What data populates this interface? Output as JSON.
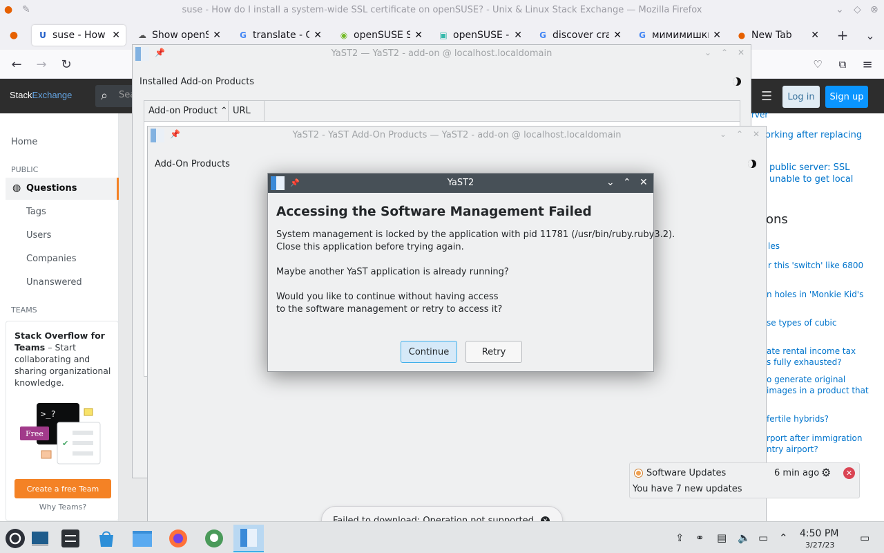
{
  "firefox": {
    "window_title": "suse - How do I install a system-wide SSL certificate on openSUSE? - Unix & Linux Stack Exchange — Mozilla Firefox",
    "tabs": [
      {
        "label": "suse - How do",
        "icon": "stackexchange-icon"
      },
      {
        "label": "Show openSU",
        "icon": "github-icon"
      },
      {
        "label": "translate - Go",
        "icon": "google-icon"
      },
      {
        "label": "openSUSE Sof",
        "icon": "opensuse-icon"
      },
      {
        "label": "openSUSE - Li",
        "icon": "opensuse-forum-icon"
      },
      {
        "label": "discover crash",
        "icon": "google-icon"
      },
      {
        "label": "мимимишки",
        "icon": "google-icon"
      },
      {
        "label": "New Tab",
        "icon": "firefox-icon"
      }
    ]
  },
  "se": {
    "logo_a": "Stack",
    "logo_b": "Exchange",
    "search_placeholder": "Sea",
    "login": "Log in",
    "signup": "Sign up",
    "nav_home": "Home",
    "nav_public": "PUBLIC",
    "nav_questions": "Questions",
    "nav_tags": "Tags",
    "nav_users": "Users",
    "nav_companies": "Companies",
    "nav_unanswered": "Unanswered",
    "nav_teams": "TEAMS",
    "teams_title": "Stack Overflow for Teams",
    "teams_desc": " – Start collaborating and sharing organizational knowledge.",
    "teams_free": "Free",
    "teams_prompt": ">_?",
    "create_team": "Create a free Team",
    "why_teams": "Why Teams?",
    "right": {
      "r0": "rver",
      "r1": "orking after replacing",
      "r2": "public server: SSL",
      "r3": "unable to get local",
      "heading": "ons",
      "r4": "les",
      "r5": "r this 'switch' like 6800",
      "r6": "n holes in 'Monkie Kid's",
      "r7": "se types of cubic",
      "r8": "ate rental income tax",
      "r9": "s fully exhausted?",
      "r10": "o generate original",
      "r11": "images in a product that",
      "r12": "fertile hybrids?",
      "r13": "rport after immigration",
      "r14": "ntry airport?"
    }
  },
  "yast1": {
    "title": "YaST2 — YaST2 - add-on @ localhost.localdomain",
    "heading": "Installed Add-on Products",
    "col_product": "Add-on Product ⌃",
    "col_url": "URL"
  },
  "yast2": {
    "title": "YaST2 - YaST Add-On Products — YaST2 - add-on @ localhost.localdomain",
    "heading": "Add-On Products"
  },
  "dialog": {
    "title": "YaST2",
    "heading": "Accessing the Software Management Failed",
    "line1": "System management is locked by the application with pid 11781 (/usr/bin/ruby.ruby3.2).",
    "line2": "Close this application before trying again.",
    "line3": "Maybe another YaST application is already running?",
    "line4": "Would you like to continue without having access",
    "line5": "to the software management or retry to access it?",
    "continue": "Continue",
    "retry": "Retry"
  },
  "notification": {
    "title": "Software Updates",
    "time": "6 min ago",
    "body": "You have 7 new updates"
  },
  "toast": {
    "text": "Failed to download: Operation not supported"
  },
  "taskbar": {
    "time": "4:50 PM",
    "date": "3/27/23"
  },
  "colors": {
    "accent": "#3daee9",
    "se_orange": "#f48225",
    "se_blue": "#0a95ff",
    "danger": "#da4453"
  }
}
